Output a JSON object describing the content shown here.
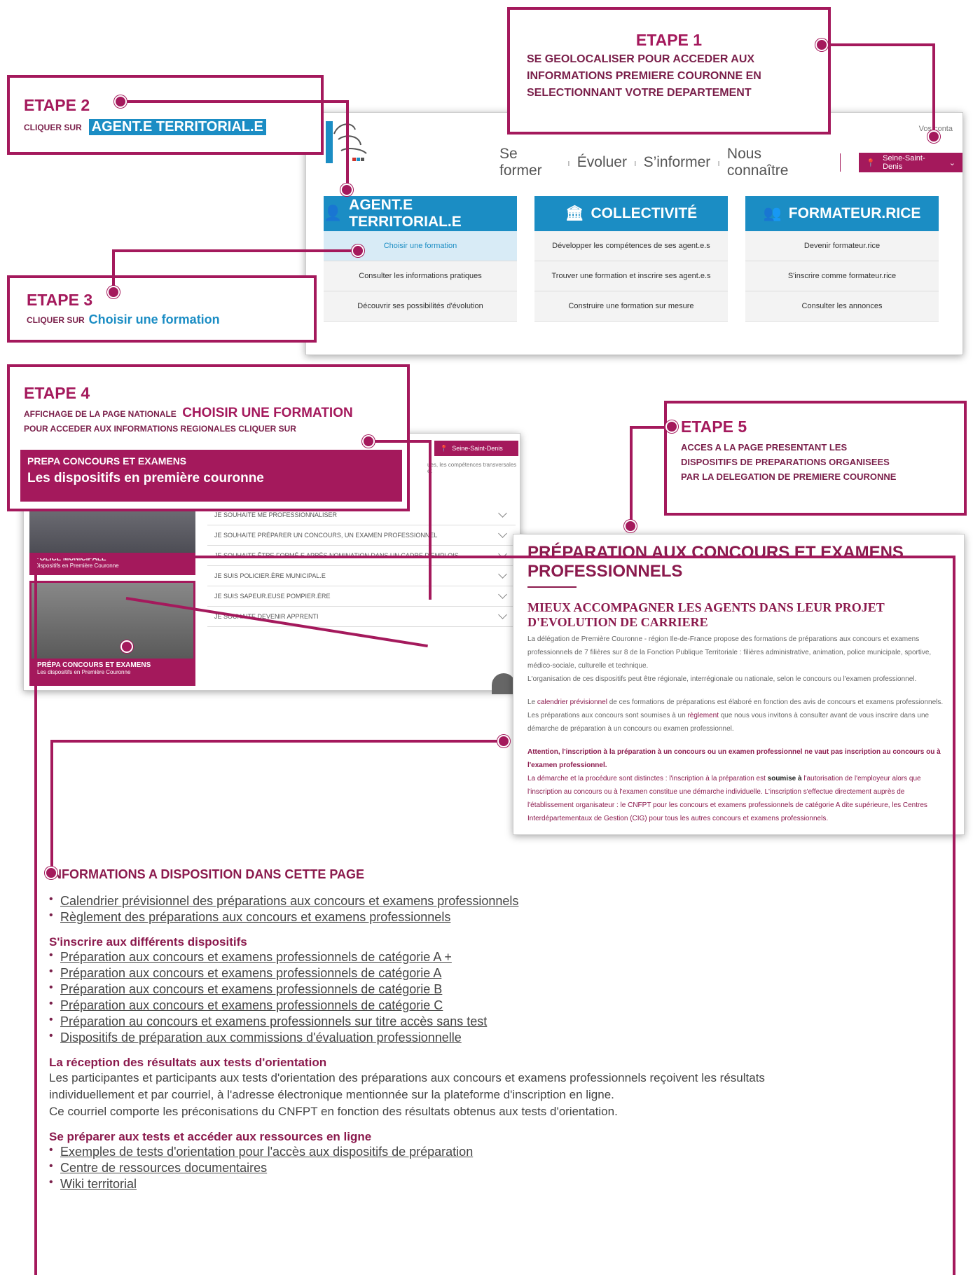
{
  "step1": {
    "title": "ETAPE 1",
    "text": "SE GEOLOCALISER POUR ACCEDER AUX INFORMATIONS PREMIERE COURONNE EN SELECTIONNANT VOTRE DEPARTEMENT"
  },
  "step2": {
    "title": "ETAPE 2",
    "prefix": "CLIQUER SUR",
    "highlight": "AGENT.E TERRITORIAL.E"
  },
  "step3": {
    "title": "ETAPE 3",
    "prefix": "CLIQUER SUR",
    "highlight": "Choisir une formation"
  },
  "step4": {
    "title": "ETAPE 4",
    "line1": "AFFICHAGE DE LA PAGE NATIONALE",
    "line1_highlight": "CHOISIR UNE FORMATION",
    "line2": "POUR ACCEDER AUX INFORMATIONS REGIONALES CLIQUER SUR",
    "banner_small": "PREPA CONCOURS ET EXAMENS",
    "banner_big": "Les dispositifs en première couronne"
  },
  "step5": {
    "title": "ETAPE 5",
    "line1": "ACCES A LA PAGE PRESENTANT LES",
    "line2": "DISPOSITIFS DE PREPARATIONS ORGANISEES",
    "line3": "PAR LA DELEGATION DE PREMIERE COURONNE"
  },
  "site": {
    "top_right": "Vos conta",
    "nav": [
      "Se former",
      "Évoluer",
      "S’informer",
      "Nous connaître"
    ],
    "location": "Seine-Saint-Denis",
    "columns": [
      {
        "head": "AGENT.E TERRITORIAL.E",
        "items": [
          "Choisir une formation",
          "Consulter les informations pratiques",
          "Découvrir ses possibilités d'évolution"
        ]
      },
      {
        "head": "COLLECTIVITÉ",
        "items": [
          "Développer les compétences de ses agent.e.s",
          "Trouver une formation et inscrire ses agent.e.s",
          "Construire une formation sur mesure"
        ]
      },
      {
        "head": "FORMATEUR.RICE",
        "items": [
          "Devenir formateur.rice",
          "S'inscrire comme formateur.rice",
          "Consulter les annonces"
        ]
      }
    ]
  },
  "page2": {
    "location": "Seine-Saint-Denis",
    "intro": "ues, les compétences transversales et",
    "card1_title": "POLICE MUNICIPALE",
    "card1_sub": "Dispositifs en Première Couronne",
    "card2_title": "PRÉPA CONCOURS ET EXAMENS",
    "card2_sub": "Les dispositifs en Première Couronne",
    "rows": [
      "JE SOUHAITE ME PROFESSIONNALISER",
      "JE SOUHAITE PRÉPARER UN CONCOURS, UN EXAMEN PROFESSIONNEL",
      "JE SOUHAITE ÊTRE FORMÉ.E APRÈS NOMINATION DANS UN CADRE D'EMPLOIS",
      "JE SUIS POLICIER.ÈRE MUNICIPAL.E",
      "JE SUIS SAPEUR.EUSE POMPIER.ÈRE",
      "JE SOUHAITE DEVENIR APPRENTI"
    ]
  },
  "page3": {
    "title": "PRÉPARATION AUX CONCOURS ET EXAMENS PROFESSIONNELS",
    "subtitle": "MIEUX ACCOMPAGNER LES AGENTS DANS LEUR PROJET D'EVOLUTION DE CARRIERE",
    "p1": "La délégation de Première Couronne - région Ile-de-France propose des formations de préparations aux concours et examens professionnels de 7 filières sur 8 de la Fonction Publique Territoriale : filières administrative, animation, police municipale, sportive, médico-sociale, culturelle et technique.",
    "p2": "L'organisation de ces dispositifs peut être régionale, interrégionale ou nationale, selon le concours ou l'examen professionnel.",
    "p3a": "Le ",
    "p3link": "calendrier prévisionnel",
    "p3b": " de ces formations de préparations est élaboré en fonction des avis de concours et examens professionnels.",
    "p4a": "Les préparations aux concours sont soumises à un ",
    "p4link": "règlement",
    "p4b": " que nous vous invitons à consulter avant de vous inscrire dans une démarche de préparation à un concours ou examen professionnel.",
    "warn": "Attention, l'inscription à la préparation à un concours ou un examen professionnel ne vaut pas inscription au concours ou à l'examen professionnel.",
    "p5a": "La démarche et la procédure sont distinctes : l'inscription à la préparation est ",
    "p5b": "soumise à",
    "p5c": " l'autorisation de l'employeur alors que l'inscription au concours ou à l'examen constitue une démarche individuelle. L'inscription s'effectue directement auprès de l'établissement organisateur : le CNFPT pour les concours et examens professionnels de catégorie A dite supérieure, les Centres Interdépartementaux de Gestion (CIG) pour tous les autres concours et examens professionnels."
  },
  "info": {
    "heading": "INFORMATIONS A DISPOSITION DANS CETTE PAGE",
    "links1": [
      "Calendrier prévisionnel des préparations aux concours et examens professionnels",
      "Règlement des préparations aux concours et examens professionnels"
    ],
    "sec1": "S'inscrire aux différents dispositifs",
    "links2": [
      "Préparation aux concours et examens professionnels de catégorie A +",
      "Préparation aux concours et examens professionnels de catégorie A",
      "Préparation aux concours et examens professionnels de catégorie B",
      "Préparation aux concours et examens professionnels de catégorie C",
      "Préparation au concours et examens professionnels sur titre accès sans test",
      "Dispositifs de préparation aux commissions d'évaluation professionnelle"
    ],
    "sec2": "La réception des résultats aux tests d'orientation",
    "para2": [
      "Les participantes et participants aux tests d'orientation des préparations aux concours et examens professionnels reçoivent les résultats",
      "individuellement et par courriel, à l'adresse électronique mentionnée sur la plateforme d'inscription en ligne.",
      "Ce courriel comporte les préconisations du CNFPT en fonction des résultats obtenus aux tests d'orientation."
    ],
    "sec3": "Se préparer aux tests et accéder aux ressources en ligne",
    "links3": [
      "Exemples de tests d'orientation pour l'accès aux dispositifs de préparation",
      "Centre de ressources documentaires",
      "Wiki territorial"
    ]
  },
  "colors": {
    "accent": "#a4195c",
    "blue": "#1b8dc4"
  }
}
